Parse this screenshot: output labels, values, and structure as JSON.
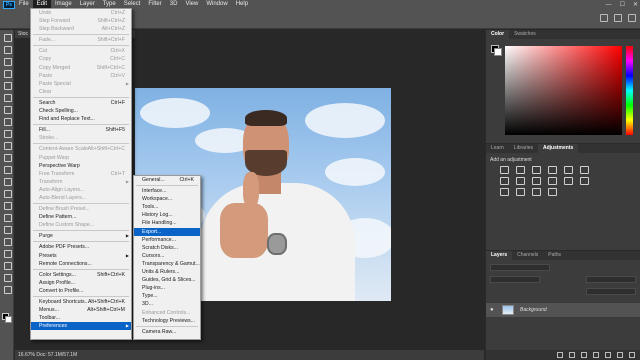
{
  "app": {
    "logo": "Ps"
  },
  "menubar": [
    {
      "label": "File"
    },
    {
      "label": "Edit"
    },
    {
      "label": "Image"
    },
    {
      "label": "Layer"
    },
    {
      "label": "Type"
    },
    {
      "label": "Select"
    },
    {
      "label": "Filter"
    },
    {
      "label": "3D"
    },
    {
      "label": "View"
    },
    {
      "label": "Window"
    },
    {
      "label": "Help"
    }
  ],
  "window_controls": {
    "minimize": "—",
    "maximize": "☐",
    "close": "✕"
  },
  "document": {
    "tab_title": "Stoc",
    "status": "16.67%"
  },
  "status_bar": {
    "info": "16.67%     Doc: 57.1M/57.1M"
  },
  "edit_menu": [
    {
      "label": "Undo",
      "shortcut": "Ctrl+Z",
      "disabled": true
    },
    {
      "label": "Step Forward",
      "shortcut": "Shift+Ctrl+Z",
      "disabled": true
    },
    {
      "label": "Step Backward",
      "shortcut": "Alt+Ctrl+Z",
      "disabled": true
    },
    {
      "sep": true
    },
    {
      "label": "Fade...",
      "shortcut": "Shift+Ctrl+F",
      "disabled": true
    },
    {
      "sep": true
    },
    {
      "label": "Cut",
      "shortcut": "Ctrl+X",
      "disabled": true
    },
    {
      "label": "Copy",
      "shortcut": "Ctrl+C",
      "disabled": true
    },
    {
      "label": "Copy Merged",
      "shortcut": "Shift+Ctrl+C",
      "disabled": true
    },
    {
      "label": "Paste",
      "shortcut": "Ctrl+V",
      "disabled": true
    },
    {
      "label": "Paste Special",
      "shortcut": "",
      "disabled": true,
      "submenu": true
    },
    {
      "label": "Clear",
      "shortcut": "",
      "disabled": true
    },
    {
      "sep": true
    },
    {
      "label": "Search",
      "shortcut": "Ctrl+F"
    },
    {
      "label": "Check Spelling..."
    },
    {
      "label": "Find and Replace Text..."
    },
    {
      "sep": true
    },
    {
      "label": "Fill...",
      "shortcut": "Shift+F5"
    },
    {
      "label": "Stroke...",
      "disabled": true
    },
    {
      "sep": true
    },
    {
      "label": "Content-Aware Scale",
      "shortcut": "Alt+Shift+Ctrl+C",
      "disabled": true
    },
    {
      "label": "Puppet Warp",
      "disabled": true
    },
    {
      "label": "Perspective Warp"
    },
    {
      "label": "Free Transform",
      "shortcut": "Ctrl+T",
      "disabled": true
    },
    {
      "label": "Transform",
      "disabled": true,
      "submenu": true
    },
    {
      "label": "Auto-Align Layers...",
      "disabled": true
    },
    {
      "label": "Auto-Blend Layers...",
      "disabled": true
    },
    {
      "sep": true
    },
    {
      "label": "Define Brush Preset...",
      "disabled": true
    },
    {
      "label": "Define Pattern..."
    },
    {
      "label": "Define Custom Shape...",
      "disabled": true
    },
    {
      "sep": true
    },
    {
      "label": "Purge",
      "submenu": true
    },
    {
      "sep": true
    },
    {
      "label": "Adobe PDF Presets..."
    },
    {
      "label": "Presets",
      "submenu": true
    },
    {
      "label": "Remote Connections..."
    },
    {
      "sep": true
    },
    {
      "label": "Color Settings...",
      "shortcut": "Shift+Ctrl+K"
    },
    {
      "label": "Assign Profile..."
    },
    {
      "label": "Convert to Profile..."
    },
    {
      "sep": true
    },
    {
      "label": "Keyboard Shortcuts...",
      "shortcut": "Alt+Shift+Ctrl+K"
    },
    {
      "label": "Menus...",
      "shortcut": "Alt+Shift+Ctrl+M"
    },
    {
      "label": "Toolbar..."
    },
    {
      "label": "Preferences",
      "submenu": true,
      "highlight": true
    }
  ],
  "prefs_menu": [
    {
      "label": "General...",
      "shortcut": "Ctrl+K"
    },
    {
      "sep": true
    },
    {
      "label": "Interface..."
    },
    {
      "label": "Workspace..."
    },
    {
      "label": "Tools..."
    },
    {
      "label": "History Log..."
    },
    {
      "label": "File Handling..."
    },
    {
      "label": "Export...",
      "highlight": true
    },
    {
      "label": "Performance..."
    },
    {
      "label": "Scratch Disks..."
    },
    {
      "label": "Cursors..."
    },
    {
      "label": "Transparency & Gamut..."
    },
    {
      "label": "Units & Rulers..."
    },
    {
      "label": "Guides, Grid & Slices..."
    },
    {
      "label": "Plug-ins..."
    },
    {
      "label": "Type..."
    },
    {
      "label": "3D..."
    },
    {
      "label": "Enhanced Controls...",
      "disabled": true
    },
    {
      "label": "Technology Previews..."
    },
    {
      "sep": true
    },
    {
      "label": "Camera Raw..."
    }
  ],
  "color_panel": {
    "tabs": [
      "Color",
      "Swatches"
    ]
  },
  "adjust_panel": {
    "tabs": [
      "Learn",
      "Libraries",
      "Adjustments"
    ],
    "label": "Add an adjustment"
  },
  "layers_panel": {
    "tabs": [
      "Layers",
      "Channels",
      "Paths"
    ],
    "layer_name": "Background",
    "eye": "●"
  }
}
